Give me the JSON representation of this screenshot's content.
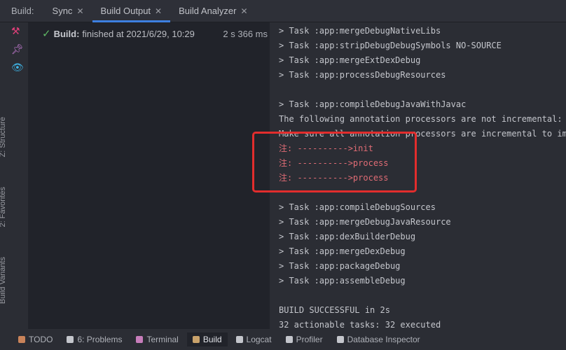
{
  "tabbar": {
    "label": "Build:",
    "tabs": [
      {
        "label": "Sync",
        "active": false
      },
      {
        "label": "Build Output",
        "active": true
      },
      {
        "label": "Build Analyzer",
        "active": false
      }
    ]
  },
  "sidebar": {
    "icons": [
      "hammer-icon",
      "pin-icon",
      "eye-icon"
    ],
    "vertical_tabs": [
      "Z: Structure",
      "2: Favorites",
      "Build Variants"
    ]
  },
  "tree": {
    "status_icon": "check-circle-icon",
    "title": "Build:",
    "text": "finished at 2021/6/29, 10:29",
    "duration": "2 s 366 ms"
  },
  "console": {
    "lines": [
      {
        "text": "> Task :app:mergeDebugNativeLibs",
        "type": "normal"
      },
      {
        "text": "> Task :app:stripDebugDebugSymbols NO-SOURCE",
        "type": "normal"
      },
      {
        "text": "> Task :app:mergeExtDexDebug",
        "type": "normal"
      },
      {
        "text": "> Task :app:processDebugResources",
        "type": "normal"
      },
      {
        "text": "",
        "type": "normal"
      },
      {
        "text": "> Task :app:compileDebugJavaWithJavac",
        "type": "normal"
      },
      {
        "text": "The following annotation processors are not incremental: pr",
        "type": "normal"
      },
      {
        "text": "Make sure all annotation processors are incremental to impr",
        "type": "normal"
      },
      {
        "text": "注: ---------->init",
        "type": "err"
      },
      {
        "text": "注: ---------->process",
        "type": "err"
      },
      {
        "text": "注: ---------->process",
        "type": "err"
      },
      {
        "text": "",
        "type": "normal"
      },
      {
        "text": "> Task :app:compileDebugSources",
        "type": "normal"
      },
      {
        "text": "> Task :app:mergeDebugJavaResource",
        "type": "normal"
      },
      {
        "text": "> Task :app:dexBuilderDebug",
        "type": "normal"
      },
      {
        "text": "> Task :app:mergeDexDebug",
        "type": "normal"
      },
      {
        "text": "> Task :app:packageDebug",
        "type": "normal"
      },
      {
        "text": "> Task :app:assembleDebug",
        "type": "normal"
      },
      {
        "text": "",
        "type": "normal"
      },
      {
        "text": "BUILD SUCCESSFUL in 2s",
        "type": "normal"
      },
      {
        "text": "32 actionable tasks: 32 executed",
        "type": "normal"
      }
    ]
  },
  "bottom": {
    "items": [
      {
        "label": "TODO",
        "icon": "todo-icon",
        "color": "#c9835a"
      },
      {
        "label": "6: Problems",
        "icon": "warning-icon",
        "color": "#c4c6cc"
      },
      {
        "label": "Terminal",
        "icon": "terminal-icon",
        "color": "#c77dbb"
      },
      {
        "label": "Build",
        "icon": "build-icon",
        "color": "#c9a26b",
        "active": true
      },
      {
        "label": "Logcat",
        "icon": "logcat-icon",
        "color": "#c4c6cc"
      },
      {
        "label": "Profiler",
        "icon": "profiler-icon",
        "color": "#c4c6cc"
      },
      {
        "label": "Database Inspector",
        "icon": "database-icon",
        "color": "#c4c6cc"
      }
    ]
  },
  "colors": {
    "accent": "#3d7fe0",
    "highlight_box": "#e22d2d",
    "error_text": "#e06c75",
    "success": "#5fb865"
  }
}
